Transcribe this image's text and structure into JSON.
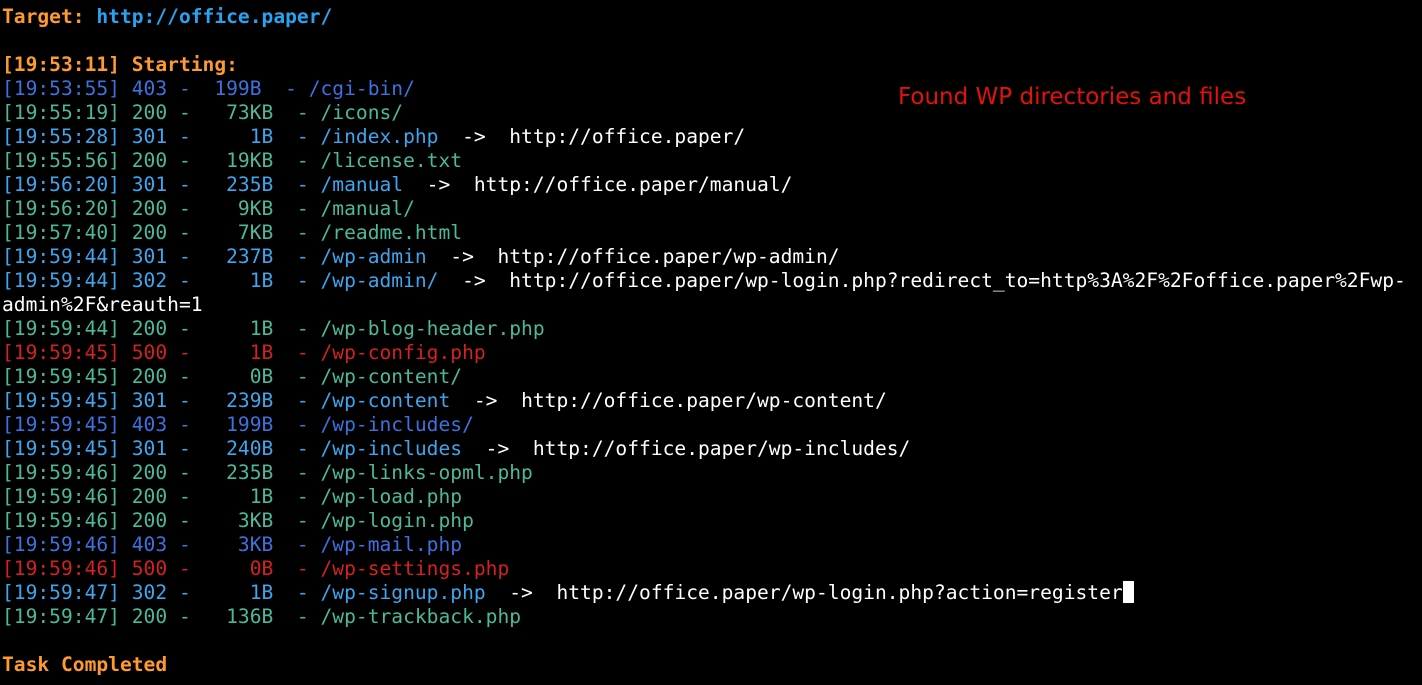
{
  "colors": {
    "background": "#000000",
    "orange": "#ff9a2e",
    "target_url": "#28a3f0",
    "status_403": "#3c72e0",
    "status_301": "#3da6ee",
    "status_302": "#3da6ee",
    "status_200": "#4cb99c",
    "status_500": "#d42121",
    "redirect_text": "#ffffff",
    "annotation": "#e3120b"
  },
  "header": {
    "target_label": "Target: ",
    "target_url": "http://office.paper/",
    "start_line": "[19:53:11] Starting:"
  },
  "annotation": "Found WP directories and files",
  "entries": [
    {
      "time": "[19:53:55]",
      "status": "403",
      "size": " 199B",
      "path": "/cgi-bin/",
      "redirect": ""
    },
    {
      "time": "[19:55:19]",
      "status": "200",
      "size": "  73KB",
      "path": "/icons/",
      "redirect": ""
    },
    {
      "time": "[19:55:28]",
      "status": "301",
      "size": "    1B",
      "path": "/index.php",
      "redirect": "http://office.paper/"
    },
    {
      "time": "[19:55:56]",
      "status": "200",
      "size": "  19KB",
      "path": "/license.txt",
      "redirect": ""
    },
    {
      "time": "[19:56:20]",
      "status": "301",
      "size": "  235B",
      "path": "/manual",
      "redirect": "http://office.paper/manual/"
    },
    {
      "time": "[19:56:20]",
      "status": "200",
      "size": "   9KB",
      "path": "/manual/",
      "redirect": ""
    },
    {
      "time": "[19:57:40]",
      "status": "200",
      "size": "   7KB",
      "path": "/readme.html",
      "redirect": ""
    },
    {
      "time": "[19:59:44]",
      "status": "301",
      "size": "  237B",
      "path": "/wp-admin",
      "redirect": "http://office.paper/wp-admin/"
    },
    {
      "time": "[19:59:44]",
      "status": "302",
      "size": "    1B",
      "path": "/wp-admin/",
      "redirect": "http://office.paper/wp-login.php?redirect_to=http%3A%2F%2Foffice.paper%2Fwp-",
      "continuation": "admin%2F&reauth=1"
    },
    {
      "time": "[19:59:44]",
      "status": "200",
      "size": "    1B",
      "path": "/wp-blog-header.php",
      "redirect": ""
    },
    {
      "time": "[19:59:45]",
      "status": "500",
      "size": "    1B",
      "path": "/wp-config.php",
      "redirect": ""
    },
    {
      "time": "[19:59:45]",
      "status": "200",
      "size": "    0B",
      "path": "/wp-content/",
      "redirect": ""
    },
    {
      "time": "[19:59:45]",
      "status": "301",
      "size": "  239B",
      "path": "/wp-content",
      "redirect": "http://office.paper/wp-content/"
    },
    {
      "time": "[19:59:45]",
      "status": "403",
      "size": "  199B",
      "path": "/wp-includes/",
      "redirect": ""
    },
    {
      "time": "[19:59:45]",
      "status": "301",
      "size": "  240B",
      "path": "/wp-includes",
      "redirect": "http://office.paper/wp-includes/"
    },
    {
      "time": "[19:59:46]",
      "status": "200",
      "size": "  235B",
      "path": "/wp-links-opml.php",
      "redirect": ""
    },
    {
      "time": "[19:59:46]",
      "status": "200",
      "size": "    1B",
      "path": "/wp-load.php",
      "redirect": ""
    },
    {
      "time": "[19:59:46]",
      "status": "200",
      "size": "   3KB",
      "path": "/wp-login.php",
      "redirect": ""
    },
    {
      "time": "[19:59:46]",
      "status": "403",
      "size": "   3KB",
      "path": "/wp-mail.php",
      "redirect": ""
    },
    {
      "time": "[19:59:46]",
      "status": "500",
      "size": "    0B",
      "path": "/wp-settings.php",
      "redirect": ""
    },
    {
      "time": "[19:59:47]",
      "status": "302",
      "size": "    1B",
      "path": "/wp-signup.php",
      "redirect": "http://office.paper/wp-login.php?action=register",
      "cursor": true
    },
    {
      "time": "[19:59:47]",
      "status": "200",
      "size": "  136B",
      "path": "/wp-trackback.php",
      "redirect": ""
    }
  ],
  "footer": "Task Completed"
}
